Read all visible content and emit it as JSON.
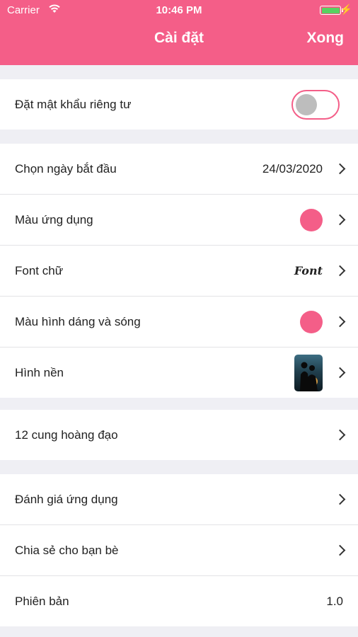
{
  "status_bar": {
    "carrier": "Carrier",
    "time": "10:46 PM",
    "battery_level": 1.0
  },
  "nav": {
    "title": "Cài đặt",
    "done": "Xong"
  },
  "colors": {
    "accent": "#f45e88",
    "background": "#efeff4",
    "knob": "#bdbdbd"
  },
  "privacy": {
    "label": "Đặt mật khẩu riêng tư",
    "toggle_on": false
  },
  "appearance": {
    "start_date": {
      "label": "Chọn ngày bắt đầu",
      "value": "24/03/2020"
    },
    "app_color": {
      "label": "Màu ứng dụng"
    },
    "font": {
      "label": "Font chữ",
      "sample": "Font"
    },
    "shape_wave_color": {
      "label": "Màu hình dáng và sóng"
    },
    "wallpaper": {
      "label": "Hình nền"
    }
  },
  "zodiac": {
    "label": "12 cung hoàng đạo"
  },
  "about": {
    "rate": {
      "label": "Đánh giá ứng dụng"
    },
    "share": {
      "label": "Chia sẻ cho bạn bè"
    },
    "version": {
      "label": "Phiên bản",
      "value": "1.0"
    }
  }
}
